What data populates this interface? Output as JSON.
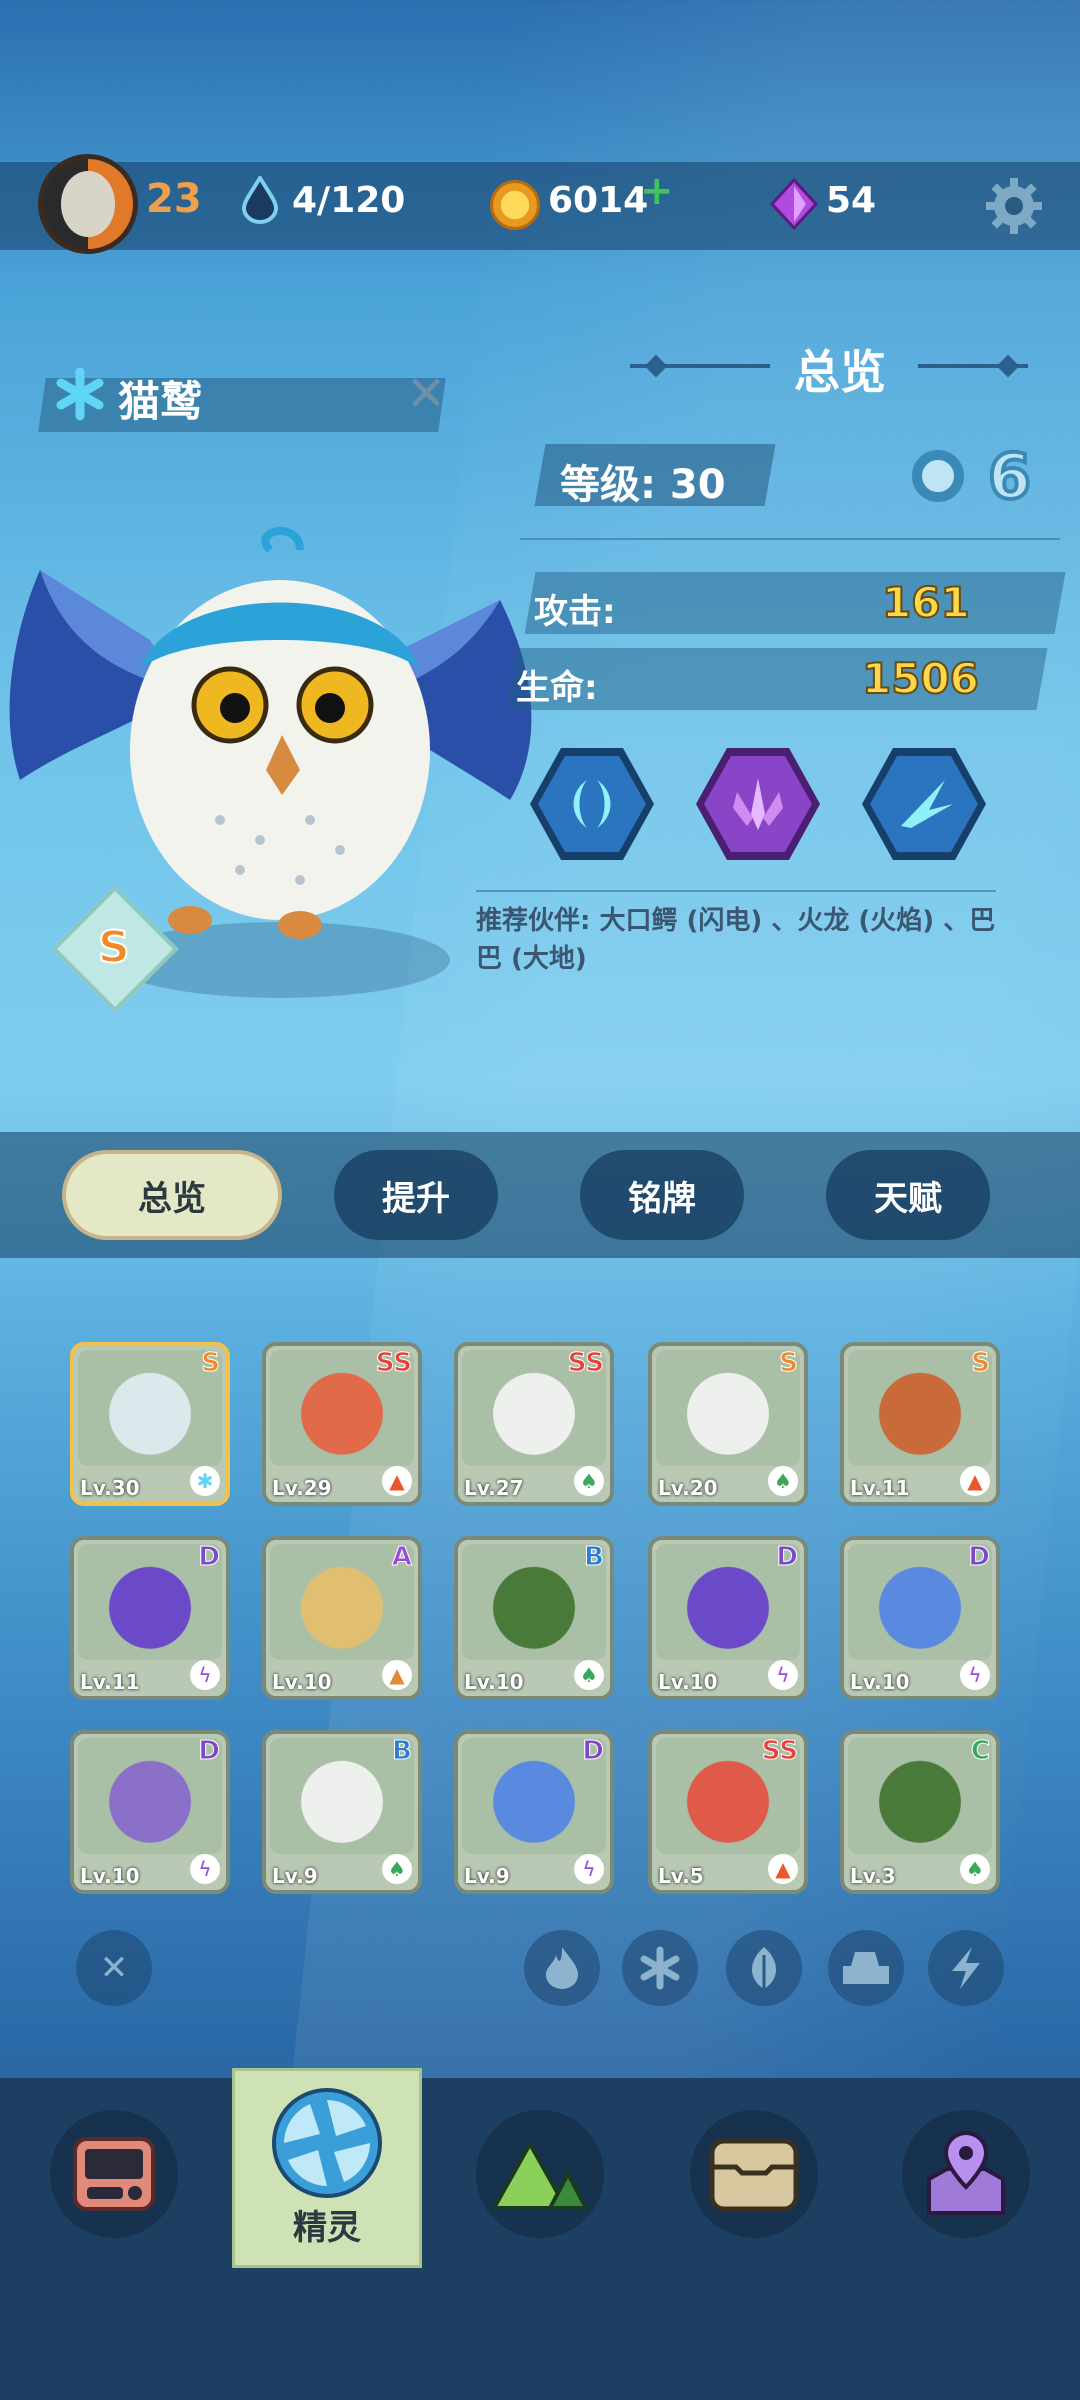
{
  "header": {
    "player_level": "23",
    "energy": "4/120",
    "coins": "6014",
    "gems": "54"
  },
  "creature": {
    "name": "猫鹫",
    "rank": "S",
    "section_title": "总览",
    "level": "等级: 30",
    "attack_label": "攻击:",
    "attack_value": "161",
    "hp_label": "生命:",
    "hp_value": "1506",
    "partner_text": "推荐伙伴: 大口鳄 (闪电) 、火龙 (火焰) 、巴巴 (大地)"
  },
  "tabs": [
    {
      "label": "总览",
      "active": true
    },
    {
      "label": "提升",
      "active": false
    },
    {
      "label": "铭牌",
      "active": false
    },
    {
      "label": "天赋",
      "active": false
    }
  ],
  "cards": [
    {
      "rank": "S",
      "level": "Lv.30",
      "element": "ice",
      "art": "owl"
    },
    {
      "rank": "SS",
      "level": "Lv.29",
      "element": "fire",
      "art": "dragon"
    },
    {
      "rank": "SS",
      "level": "Lv.27",
      "element": "grass",
      "art": "panda"
    },
    {
      "rank": "S",
      "level": "Lv.20",
      "element": "grass",
      "art": "panda"
    },
    {
      "rank": "S",
      "level": "Lv.11",
      "element": "fire",
      "art": "robot"
    },
    {
      "rank": "D",
      "level": "Lv.11",
      "element": "lightning",
      "art": "cat"
    },
    {
      "rank": "A",
      "level": "Lv.10",
      "element": "earth",
      "art": "skull"
    },
    {
      "rank": "B",
      "level": "Lv.10",
      "element": "grass",
      "art": "hood"
    },
    {
      "rank": "D",
      "level": "Lv.10",
      "element": "lightning",
      "art": "cat"
    },
    {
      "rank": "D",
      "level": "Lv.10",
      "element": "lightning",
      "art": "cannon"
    },
    {
      "rank": "D",
      "level": "Lv.10",
      "element": "lightning",
      "art": "mouse"
    },
    {
      "rank": "B",
      "level": "Lv.9",
      "element": "grass",
      "art": "panda"
    },
    {
      "rank": "D",
      "level": "Lv.9",
      "element": "lightning",
      "art": "cannon"
    },
    {
      "rank": "SS",
      "level": "Lv.5",
      "element": "fire",
      "art": "blob"
    },
    {
      "rank": "C",
      "level": "Lv.3",
      "element": "grass",
      "art": "hood"
    }
  ],
  "filters": [
    "fire-icon",
    "ice-icon",
    "leaf-icon",
    "earth-icon",
    "lightning-icon"
  ],
  "bottom_nav": [
    {
      "icon": "screen-icon",
      "label": ""
    },
    {
      "icon": "shutter-icon",
      "label": "精灵",
      "active": true
    },
    {
      "icon": "mountain-icon",
      "label": ""
    },
    {
      "icon": "chest-icon",
      "label": ""
    },
    {
      "icon": "map-pin-icon",
      "label": ""
    }
  ],
  "colors": {
    "rank_SS": "#e8403a",
    "rank_S": "#f08a28",
    "rank_A": "#9a4ad8",
    "rank_B": "#2a7ad8",
    "rank_C": "#3aa85a",
    "rank_D": "#7a4ac8",
    "stat_value": "#ffd84a",
    "player_level": "#f0a04a"
  }
}
